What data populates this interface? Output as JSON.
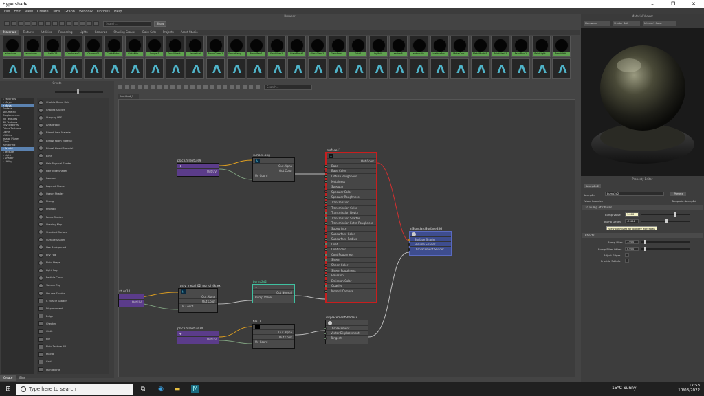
{
  "window": {
    "title": "Hypershade",
    "min": "–",
    "max": "❐",
    "close": "✕"
  },
  "menu": [
    "File",
    "Edit",
    "View",
    "Create",
    "Tabs",
    "Graph",
    "Window",
    "Options",
    "Help"
  ],
  "browser": {
    "title": "Browser",
    "search_placeholder": "Search...",
    "show_label": "Show",
    "tabs": [
      "Materials",
      "Textures",
      "Utilities",
      "Rendering",
      "Lights",
      "Cameras",
      "Shading Groups",
      "Bake Sets",
      "Projects",
      "Asset Studio"
    ],
    "active_tab": "Materials",
    "materials_row1": [
      "aluminum...",
      "aluminum...",
      "Cable13",
      "Cardboard1",
      "Chrome01",
      "ClothWater1",
      "ClothMtlr...",
      "Copper1",
      "DecalSheet1",
      "FenceBurl",
      "FenceGreen1",
      "FenceHang...",
      "FenceRed1",
      "FinnSilver1",
      "GlassBlack1",
      "GlassClear1",
      "GlassFrost...",
      "Gold1",
      "Ivy/fall1",
      "Leather8...",
      "LeatherBla...",
      "LeatherBro...",
      "MetalCorr...",
      "MetalRust01",
      "PaintBlack1",
      "PaintBlue1",
      "PaintLight...",
      "PaintWhit..."
    ],
    "materials_row2_count": 28
  },
  "create": {
    "title": "Create",
    "tree": [
      {
        "label": "▸ Favorites",
        "sel": false
      },
      {
        "label": "  ▸ Maya",
        "sel": false
      },
      {
        "label": "▾ Maya",
        "sel": true
      },
      {
        "label": "  Surface",
        "sel": false
      },
      {
        "label": "  Volumetric",
        "sel": false
      },
      {
        "label": "  Displacement",
        "sel": false
      },
      {
        "label": "  2D Textures",
        "sel": false
      },
      {
        "label": "  3D Textures",
        "sel": false
      },
      {
        "label": "  Env Textures",
        "sel": false
      },
      {
        "label": "  Other Textures",
        "sel": false
      },
      {
        "label": "  Lights",
        "sel": false
      },
      {
        "label": "  Utilities",
        "sel": false
      },
      {
        "label": "  Image Planes",
        "sel": false
      },
      {
        "label": "  Glow",
        "sel": false
      },
      {
        "label": "  Rendering",
        "sel": false
      },
      {
        "label": "▾ Arnold",
        "sel": true
      },
      {
        "label": "  ▸ Texture",
        "sel": false
      },
      {
        "label": "  ▸ Light",
        "sel": false
      },
      {
        "label": "  ▸ Shader",
        "sel": false
      },
      {
        "label": "  ▸ Utility",
        "sel": false
      }
    ],
    "items": [
      "Chalkfx Game Hair",
      "Chalkfx Shader",
      "Stingray PBS",
      "Anisotropic",
      "Bifrost Aero Material",
      "Bifrost Foam Material",
      "Bifrost Liquid Material",
      "Blinn",
      "Hair Physical Shader",
      "Hair Tube Shader",
      "Lambert",
      "Layered Shader",
      "Ocean Shader",
      "Phong",
      "Phong E",
      "Ramp Shader",
      "Shading Map",
      "Standard Surface",
      "Surface Shader",
      "Use Background",
      "Env Fog",
      "Fluid Shape",
      "Light Fog",
      "Particle Cloud",
      "Volume Fog",
      "Volume Shader",
      "C Muscle Shader",
      "Displacement",
      "Bulge",
      "Checker",
      "Cloth",
      "File",
      "Fluid Texture 2D",
      "Fractal",
      "Grid",
      "Mandelbrot"
    ],
    "bottom_tabs": [
      "Create",
      "Bins"
    ]
  },
  "node_editor": {
    "search_placeholder": "Search...",
    "tab": "Untitled_1",
    "nodes": {
      "place2d9": {
        "title": "place2dTexture9",
        "out": "Out UV"
      },
      "surface_png": {
        "title": "surface.png",
        "outs": [
          "Out Alpha",
          "Out Color"
        ],
        "in": "Uv Coord"
      },
      "surface11": {
        "title": "surface11",
        "out": "Out Color",
        "attrs": [
          "Base",
          "Base Color",
          "Diffuse Roughness",
          "Metalness",
          "Specular",
          "Specular Color",
          "Specular Roughness",
          "Transmission",
          "Transmission Color",
          "Transmission Depth",
          "Transmission Scatter",
          "Transmission Extra Roughness",
          "Subsurface",
          "Subsurface Color",
          "Subsurface Radius",
          "Coat",
          "Coat Color",
          "Coat Roughness",
          "Sheen",
          "Sheen Color",
          "Sheen Roughness",
          "Emission",
          "Emission Color",
          "Opacity",
          "Normal Camera"
        ]
      },
      "sg": {
        "title": "aiStandardSurface8SG",
        "attrs": [
          "Surface Shader",
          "Volume Shader",
          "Displacement Shader"
        ]
      },
      "tex10": {
        "title": "xture10",
        "out": "Out UV"
      },
      "rusty": {
        "title": "rusty_metal_02_nor_gl_4k.exr",
        "outs": [
          "Out Alpha",
          "Out Color"
        ],
        "in": "Uv Coord"
      },
      "bump": {
        "title": "bump2d2",
        "out": "Out Normal",
        "in": "Bump Value"
      },
      "place2d20": {
        "title": "place2dTexture20",
        "out": "Out UV"
      },
      "file17": {
        "title": "file17",
        "outs": [
          "Out Alpha",
          "Out Color"
        ],
        "in": "Uv Coord"
      },
      "disp": {
        "title": "displacementShader3",
        "attrs": [
          "Displacement",
          "Vector Displacement",
          "Tangent"
        ]
      }
    }
  },
  "viewer": {
    "title": "Material Viewer",
    "renderer": "Hardware",
    "shape": "Shader Ball",
    "env": "Interior1 Color"
  },
  "property": {
    "title": "Property Editor",
    "tab": "bump2d2",
    "node_label": "bump2d",
    "node_value": "bump2d2",
    "presets": "Presets",
    "view_label": "View: Lookdev",
    "template_label": "Template: bump2d",
    "sec1": "2d Bump Attributes",
    "bump_value_label": "Bump Value",
    "bump_value": "1.000",
    "bump_depth_label": "Bump Depth",
    "bump_depth": "-0.464",
    "tooltip": "View optimized for lookdev workflows",
    "sec2": "Effects",
    "bump_filter_label": "Bump Filter",
    "bump_filter": "1.000",
    "bump_filter_offset_label": "Bump Filter Offset",
    "bump_filter_offset": "0.000",
    "adjust_edges": "Adjust Edges",
    "provide3d": "Provide 3d Info"
  },
  "taskbar": {
    "search": "Type here to search",
    "weather": "15°C Sunny",
    "time": "17:58",
    "date": "10/03/2022"
  }
}
